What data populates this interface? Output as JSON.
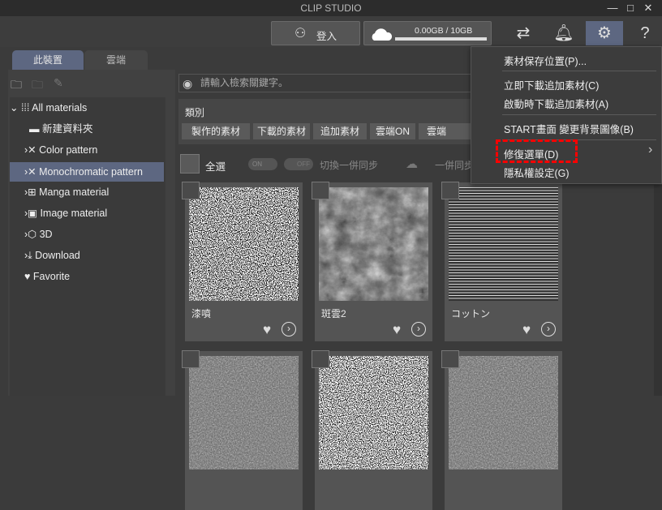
{
  "title": "CLIP STUDIO",
  "window": {
    "minimize": "—",
    "maximize": "□",
    "close": "✕"
  },
  "toolbar": {
    "login": "登入",
    "storage": "0.00GB / 10GB",
    "storage_fraction": 0.0
  },
  "tabs": [
    {
      "label": "此裝置"
    },
    {
      "label": "雲端"
    }
  ],
  "tree": [
    {
      "label": "All materials"
    },
    {
      "label": "新建資料夾"
    },
    {
      "label": "Color pattern"
    },
    {
      "label": "Monochromatic pattern"
    },
    {
      "label": "Manga material"
    },
    {
      "label": "Image material"
    },
    {
      "label": "3D"
    },
    {
      "label": "Download"
    },
    {
      "label": "Favorite"
    }
  ],
  "search": {
    "placeholder": "請輸入檢索關鍵字。"
  },
  "category": {
    "title": "類別",
    "chips": [
      "製作的素材",
      "下載的素材",
      "追加素材",
      "雲端ON",
      "雲端"
    ]
  },
  "select": {
    "all": "全選",
    "on": "ON",
    "off": "OFF",
    "sync_toggle": "切換一併同步",
    "sync": "一併同步"
  },
  "cards": [
    {
      "label": "漆噴"
    },
    {
      "label": "斑雲2"
    },
    {
      "label": "コットン"
    }
  ],
  "menu": {
    "items": [
      "素材保存位置(P)...",
      "立即下載追加素材(C)",
      "啟動時下載追加素材(A)",
      "START畫面 變更背景圖像(B)",
      "修復選單(D)",
      "隱私權設定(G)"
    ],
    "submenu_arrow": "›"
  },
  "colors": {
    "accent": "#5d6781",
    "highlight": "#ff0000"
  }
}
